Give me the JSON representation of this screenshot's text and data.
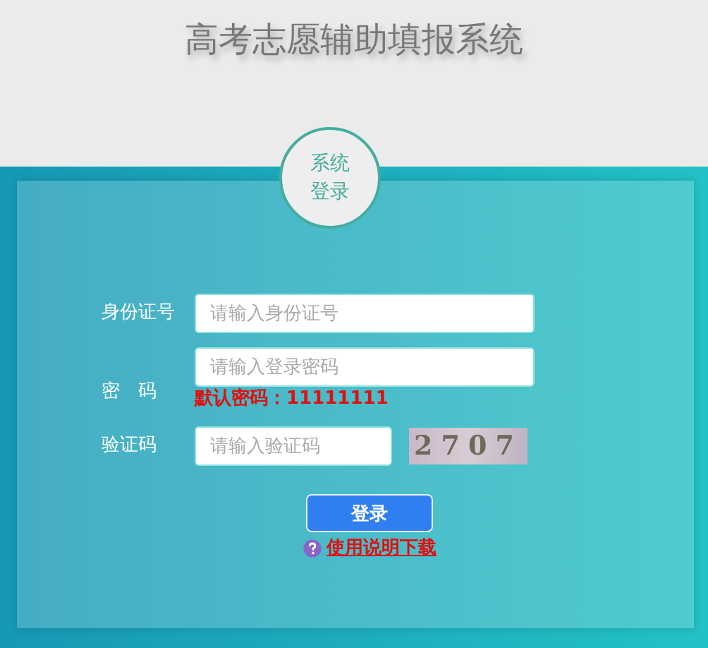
{
  "header": {
    "title": "高考志愿辅助填报系统"
  },
  "badge": {
    "lines": [
      "系统",
      "登录"
    ]
  },
  "form": {
    "fields": [
      {
        "label": "身份证号",
        "placeholder": "请输入身份证号",
        "kind": "text"
      },
      {
        "label": "密　码",
        "placeholder": "请输入登录密码",
        "kind": "password",
        "note": "默认密码：11111111"
      },
      {
        "label": "验证码",
        "placeholder": "请输入验证码",
        "kind": "captcha",
        "captcha_text": "2707"
      }
    ],
    "submit": "登录",
    "help_link": "使用说明下载"
  }
}
